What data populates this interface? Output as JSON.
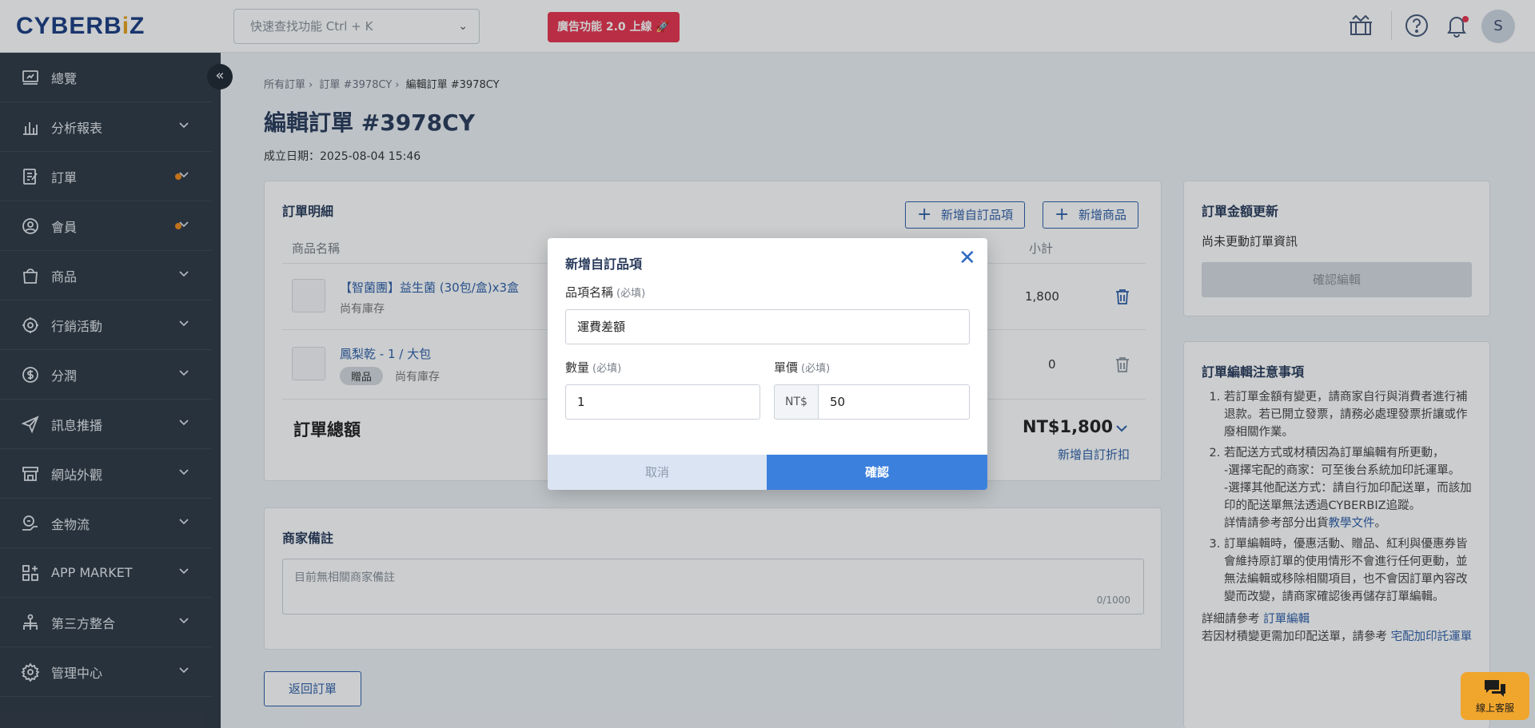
{
  "header": {
    "logo_left": "CYBERB",
    "logo_dot": "i",
    "logo_right": "Z",
    "search_placeholder": "快速查找功能 Ctrl + K",
    "promo": "廣告功能 2.0 上線 🚀",
    "avatar_initial": "S"
  },
  "sidebar": {
    "items": [
      {
        "label": "總覽",
        "icon": "dashboard-icon"
      },
      {
        "label": "分析報表",
        "icon": "bar-chart-icon"
      },
      {
        "label": "訂單",
        "icon": "order-icon"
      },
      {
        "label": "會員",
        "icon": "user-icon"
      },
      {
        "label": "商品",
        "icon": "shopping-bag-icon"
      },
      {
        "label": "行銷活動",
        "icon": "marketing-gear-icon"
      },
      {
        "label": "分潤",
        "icon": "dollar-icon"
      },
      {
        "label": "訊息推播",
        "icon": "send-icon"
      },
      {
        "label": "網站外觀",
        "icon": "storefront-icon"
      },
      {
        "label": "金物流",
        "icon": "logistics-icon"
      },
      {
        "label": "APP MARKET",
        "icon": "app-grid-icon"
      },
      {
        "label": "第三方整合",
        "icon": "integration-icon"
      },
      {
        "label": "管理中心",
        "icon": "settings-icon"
      }
    ]
  },
  "breadcrumb": [
    "所有訂單",
    "訂單 #3978CY",
    "編輯訂單 #3978CY"
  ],
  "page": {
    "title": "編輯訂單 #3978CY",
    "created": "成立日期：2025-08-04 15:46"
  },
  "order_detail": {
    "title": "訂單明細",
    "add_custom": "新增自訂品項",
    "add_product": "新增商品",
    "col_name": "商品名稱",
    "col_subtotal": "小計",
    "items": [
      {
        "name": "【智菌團】益生菌 (30包/盒)x3盒",
        "stock": "尚有庫存",
        "tag": "",
        "subtotal": "1,800"
      },
      {
        "name": "鳳梨乾 - 1 / 大包",
        "stock": "尚有庫存",
        "tag": "贈品",
        "subtotal": "0"
      }
    ],
    "total_label": "訂單總額",
    "total_value": "NT$1,800",
    "add_discount": "新增自訂折扣"
  },
  "merchant_note": {
    "title": "商家備註",
    "placeholder": "目前無相關商家備註",
    "counter": "0/1000"
  },
  "back_button": "返回訂單",
  "amount_update": {
    "title": "訂單金額更新",
    "status": "尚未更動訂單資訊",
    "confirm": "確認編輯"
  },
  "notes": {
    "title": "訂單編輯注意事項",
    "n1": "若訂單金額有變更，請商家自行與消費者進行補退款。若已開立發票，請務必處理發票折讓或作廢相關作業。",
    "n2a": "若配送方式或材積因為訂單編輯有所更動，",
    "n2b": "-選擇宅配的商家：可至後台系統加印託運單。",
    "n2c": "-選擇其他配送方式：請自行加印配送單，而該加印的配送單無法透過CYBERBIZ追蹤。",
    "n2d": "詳情請參考部分出貨",
    "n2e": "教學文件",
    "n2f": "。",
    "n3": "訂單編輯時，優惠活動、贈品、紅利與優惠券皆會維持原訂單的使用情形不會進行任何更動，並無法編輯或移除相關項目，也不會因訂單內容改變而改變，請商家確認後再儲存訂單編輯。",
    "ref1a": "詳細請參考",
    "ref1b": "訂單編輯",
    "ref2a": "若因材積變更需加印配送單，請參考",
    "ref2b": "宅配加印託運單"
  },
  "modal": {
    "title": "新增自訂品項",
    "close": "✕",
    "name_label": "品項名稱",
    "required": "(必填)",
    "name_value": "運費差額",
    "qty_label": "數量",
    "qty_value": "1",
    "price_label": "單價",
    "currency": "NT$",
    "price_value": "50",
    "cancel": "取消",
    "confirm": "確認"
  },
  "chat": {
    "label": "線上客服"
  },
  "colors": {
    "brand": "#1b3d83",
    "accent": "#3c80dd",
    "promo": "#e8344f",
    "badge": "#f08a1a"
  }
}
